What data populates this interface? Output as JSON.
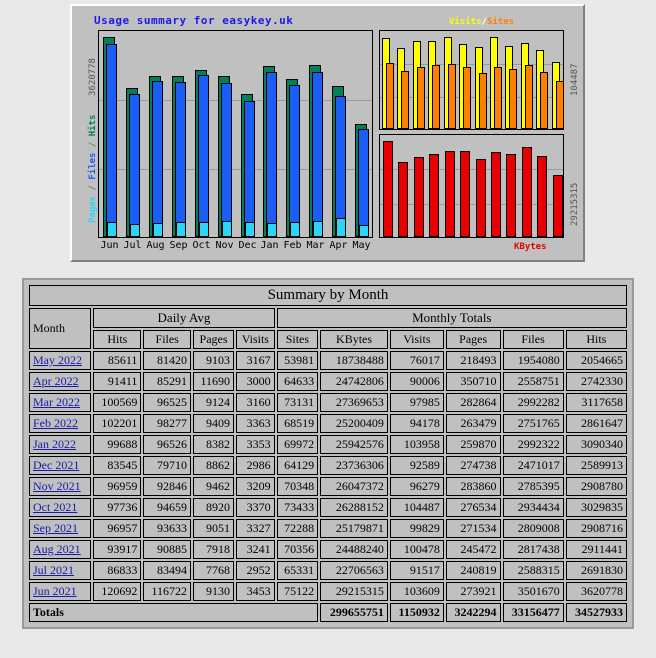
{
  "chart": {
    "title": "Usage summary for easykey.uk",
    "left_axis_top_label": "3620778",
    "left_axis_series_label": [
      "Pages",
      "/",
      "Files",
      "/",
      "Hits"
    ],
    "right_axis_top_label": "104487",
    "right_axis_bottom_label": "29215315",
    "legend_visits": "Visits",
    "legend_slash": "/",
    "legend_sites": "Sites",
    "legend_kbytes": "KBytes",
    "colors": {
      "hits": "#00805c",
      "files": "#1b5ef5",
      "pages": "#2ad5f5",
      "visits": "#ffff00",
      "sites": "#ff8000",
      "kbytes": "#e80000",
      "background": "#c0c0c0",
      "title": "#1a1aee"
    }
  },
  "chart_data": {
    "type": "bar",
    "title": "Usage summary for easykey.uk",
    "categories": [
      "Jun",
      "Jul",
      "Aug",
      "Sep",
      "Oct",
      "Nov",
      "Dec",
      "Jan",
      "Feb",
      "Mar",
      "Apr",
      "May"
    ],
    "panels": [
      {
        "name": "Pages / Files / Hits",
        "ymax": 3620778,
        "series": [
          {
            "name": "Hits",
            "color": "#00805c",
            "values": [
              3620778,
              2691830,
              2911441,
              2908716,
              3029835,
              2908780,
              2589913,
              3090340,
              2861647,
              3117658,
              2742330,
              2054665
            ]
          },
          {
            "name": "Files",
            "color": "#1b5ef5",
            "values": [
              3501670,
              2588315,
              2817438,
              2809008,
              2934434,
              2785395,
              2471017,
              2992322,
              2751765,
              2992282,
              2558751,
              1954080
            ]
          },
          {
            "name": "Pages",
            "color": "#2ad5f5",
            "values": [
              273921,
              240819,
              245472,
              271534,
              276534,
              283860,
              274738,
              259870,
              263479,
              282864,
              350710,
              218493
            ]
          }
        ]
      },
      {
        "name": "Visits / Sites",
        "ymax": 104487,
        "series": [
          {
            "name": "Visits",
            "color": "#ffff00",
            "values": [
              103609,
              91517,
              100478,
              99829,
              104487,
              96279,
              92589,
              103958,
              94178,
              97985,
              90006,
              76017
            ]
          },
          {
            "name": "Sites",
            "color": "#ff8000",
            "values": [
              75122,
              65331,
              70356,
              72288,
              73433,
              70348,
              64129,
              69972,
              68519,
              73131,
              64633,
              53981
            ]
          }
        ]
      },
      {
        "name": "KBytes",
        "ymax": 29215315,
        "series": [
          {
            "name": "KBytes",
            "color": "#e80000",
            "values": [
              29215315,
              22706563,
              24488240,
              25179871,
              26288152,
              26047372,
              23736306,
              25942576,
              25200409,
              27369653,
              24742806,
              18738488
            ]
          }
        ]
      }
    ],
    "xlabel": "",
    "ylabel": "Pages / Files / Hits",
    "grid": true,
    "legend_position": "top-right"
  },
  "table": {
    "title": "Summary by Month",
    "col_month": "Month",
    "group_daily": "Daily Avg",
    "group_monthly": "Monthly Totals",
    "headers": [
      "Hits",
      "Files",
      "Pages",
      "Visits",
      "Sites",
      "KBytes",
      "Visits",
      "Pages",
      "Files",
      "Hits"
    ],
    "rows": [
      {
        "month": "May 2022",
        "cells": [
          "85611",
          "81420",
          "9103",
          "3167",
          "53981",
          "18738488",
          "76017",
          "218493",
          "1954080",
          "2054665"
        ]
      },
      {
        "month": "Apr 2022",
        "cells": [
          "91411",
          "85291",
          "11690",
          "3000",
          "64633",
          "24742806",
          "90006",
          "350710",
          "2558751",
          "2742330"
        ]
      },
      {
        "month": "Mar 2022",
        "cells": [
          "100569",
          "96525",
          "9124",
          "3160",
          "73131",
          "27369653",
          "97985",
          "282864",
          "2992282",
          "3117658"
        ]
      },
      {
        "month": "Feb 2022",
        "cells": [
          "102201",
          "98277",
          "9409",
          "3363",
          "68519",
          "25200409",
          "94178",
          "263479",
          "2751765",
          "2861647"
        ]
      },
      {
        "month": "Jan 2022",
        "cells": [
          "99688",
          "96526",
          "8382",
          "3353",
          "69972",
          "25942576",
          "103958",
          "259870",
          "2992322",
          "3090340"
        ]
      },
      {
        "month": "Dec 2021",
        "cells": [
          "83545",
          "79710",
          "8862",
          "2986",
          "64129",
          "23736306",
          "92589",
          "274738",
          "2471017",
          "2589913"
        ]
      },
      {
        "month": "Nov 2021",
        "cells": [
          "96959",
          "92846",
          "9462",
          "3209",
          "70348",
          "26047372",
          "96279",
          "283860",
          "2785395",
          "2908780"
        ]
      },
      {
        "month": "Oct 2021",
        "cells": [
          "97736",
          "94659",
          "8920",
          "3370",
          "73433",
          "26288152",
          "104487",
          "276534",
          "2934434",
          "3029835"
        ]
      },
      {
        "month": "Sep 2021",
        "cells": [
          "96957",
          "93633",
          "9051",
          "3327",
          "72288",
          "25179871",
          "99829",
          "271534",
          "2809008",
          "2908716"
        ]
      },
      {
        "month": "Aug 2021",
        "cells": [
          "93917",
          "90885",
          "7918",
          "3241",
          "70356",
          "24488240",
          "100478",
          "245472",
          "2817438",
          "2911441"
        ]
      },
      {
        "month": "Jul 2021",
        "cells": [
          "86833",
          "83494",
          "7768",
          "2952",
          "65331",
          "22706563",
          "91517",
          "240819",
          "2588315",
          "2691830"
        ]
      },
      {
        "month": "Jun 2021",
        "cells": [
          "120692",
          "116722",
          "9130",
          "3453",
          "75122",
          "29215315",
          "103609",
          "273921",
          "3501670",
          "3620778"
        ]
      }
    ],
    "totals_label": "Totals",
    "totals": [
      "299655751",
      "1150932",
      "3242294",
      "33156477",
      "34527933"
    ]
  }
}
